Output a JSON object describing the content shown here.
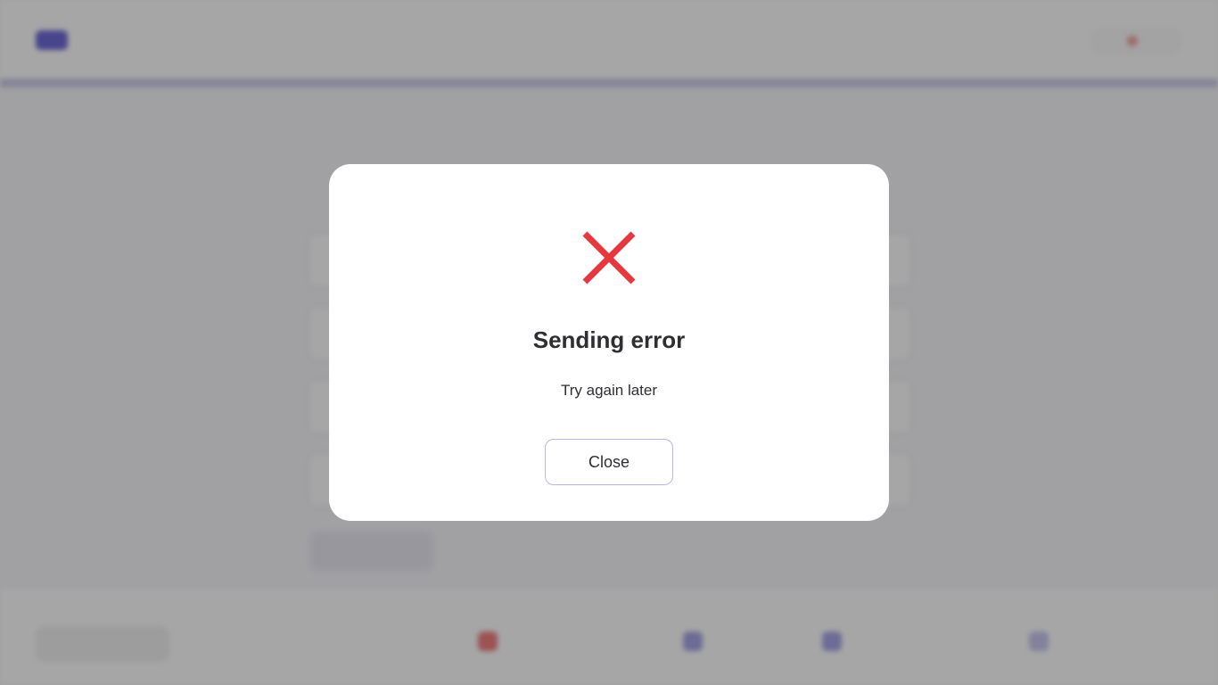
{
  "background": {
    "timer": {
      "label": ""
    },
    "question": "",
    "options": [
      "",
      "",
      "",
      ""
    ],
    "submit_label": "",
    "bottombar": {
      "back_label": "",
      "items": [
        {
          "label": "",
          "icon": "flag-icon",
          "color": "#f08080"
        },
        {
          "label": "",
          "icon": "grid-icon",
          "color": "#6f6ad8"
        },
        {
          "label": "",
          "icon": "bookmark-icon",
          "color": "#6f6ad8"
        },
        {
          "label": "",
          "icon": "arrow-right-icon",
          "color": "#6f6ad8"
        }
      ]
    }
  },
  "modal": {
    "icon": "close-x-icon",
    "icon_color": "#e5393f",
    "title": "Sending error",
    "message": "Try again later",
    "close_label": "Close"
  }
}
